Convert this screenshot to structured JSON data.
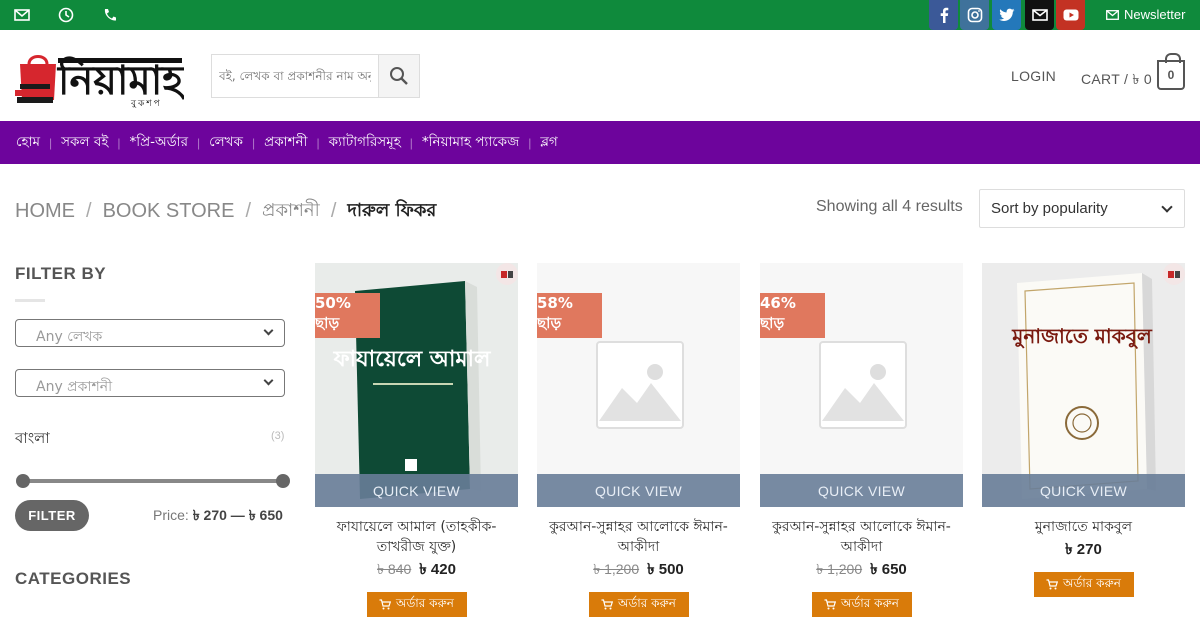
{
  "topbar": {
    "icons": [
      "envelope-icon",
      "clock-icon",
      "phone-icon"
    ],
    "social": [
      "facebook-icon",
      "instagram-icon",
      "twitter-icon",
      "email-icon",
      "youtube-icon"
    ],
    "newsletter_label": "Newsletter",
    "color": "#0f8a3c"
  },
  "header": {
    "logo_text": "নিয়ামাহ",
    "logo_subtext": "বুকশপ",
    "search_placeholder": "বই, লেখক বা প্রকাশনীর নাম অনুসন্ধান করুন",
    "login_label": "LOGIN",
    "cart_label": "CART / ৳ 0",
    "cart_count": "0"
  },
  "nav": {
    "color": "#6d049c",
    "items": [
      "হোম",
      "সকল বই",
      "*প্রি-অর্ডার",
      "লেখক",
      "প্রকাশনী",
      "ক্যাটাগরিসমূহ",
      "*নিয়ামাহ প্যাকেজ",
      "ব্লগ"
    ]
  },
  "breadcrumb": {
    "home": "HOME",
    "store": "BOOK STORE",
    "publisher": "প্রকাশনী",
    "current": "দারুল ফিকর"
  },
  "results_text": "Showing all 4 results",
  "sort_selected": "Sort by popularity",
  "sidebar": {
    "filter_title": "FILTER BY",
    "author_select": "Any লেখক",
    "publisher_select": "Any প্রকাশনী",
    "language": "বাংলা",
    "language_count": "(3)",
    "filter_button": "FILTER",
    "price_label": "Price:",
    "price_range": "৳ 270 — ৳ 650",
    "categories_title": "CATEGORIES"
  },
  "products": [
    {
      "title": "ফাযায়েলে আমাল (তাহকীক-তাখরীজ যুক্ত)",
      "badge": "50% ছাড়",
      "old_price": "৳ 840",
      "price": "৳ 420",
      "quick_view": "QUICK VIEW",
      "order_label": "অর্ডার করুন",
      "cover": "green-book",
      "cover_title": "ফাযায়েলে আমাল"
    },
    {
      "title": "কুরআন-সুন্নাহর আলোকে ঈমান-আকীদা",
      "badge": "58% ছাড়",
      "old_price": "৳ 1,200",
      "price": "৳ 500",
      "quick_view": "QUICK VIEW",
      "order_label": "অর্ডার করুন",
      "cover": "placeholder"
    },
    {
      "title": "কুরআন-সুন্নাহর আলোকে ঈমান-আকীদা",
      "badge": "46% ছাড়",
      "old_price": "৳ 1,200",
      "price": "৳ 650",
      "quick_view": "QUICK VIEW",
      "order_label": "অর্ডার করুন",
      "cover": "placeholder"
    },
    {
      "title": "মুনাজাতে মাকবুল",
      "badge": "",
      "old_price": "",
      "price": "৳ 270",
      "quick_view": "QUICK VIEW",
      "order_label": "অর্ডার করুন",
      "cover": "white-book",
      "cover_title": "মুনাজাতে মাকবুল"
    }
  ]
}
